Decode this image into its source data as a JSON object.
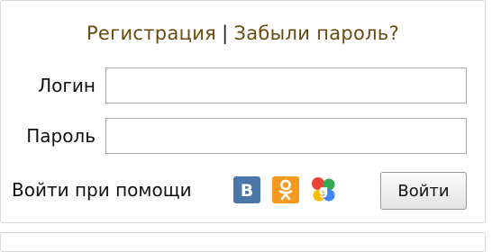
{
  "header": {
    "register_link": "Регистрация",
    "separator": "|",
    "forgot_link": "Забыли пароль?"
  },
  "form": {
    "login_label": "Логин",
    "login_value": "",
    "password_label": "Пароль",
    "password_value": ""
  },
  "social": {
    "label": "Войти при помощи",
    "providers": [
      {
        "name": "vk-icon",
        "glyph": "В",
        "color": "#4a76a8"
      },
      {
        "name": "odnoklassniki-icon",
        "color": "#f59a1e"
      },
      {
        "name": "google-icon",
        "color": "#4285f4"
      }
    ]
  },
  "actions": {
    "login_button": "Войти"
  }
}
